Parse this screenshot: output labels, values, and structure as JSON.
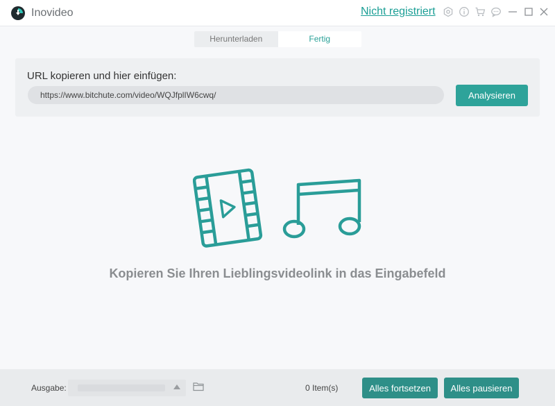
{
  "app": {
    "title": "Inovideo",
    "register_link": "Nicht registriert",
    "accent_color": "#2aa198"
  },
  "titlebar_icons": [
    "settings-icon",
    "info-icon",
    "cart-icon",
    "feedback-icon",
    "minimize-icon",
    "maximize-icon",
    "close-icon"
  ],
  "tabs": [
    {
      "label": "Herunterladen",
      "active": false
    },
    {
      "label": "Fertig",
      "active": true
    }
  ],
  "url_panel": {
    "label": "URL kopieren und hier einfügen:",
    "value": "https://www.bitchute.com/video/WQJfplIW6cwq/",
    "analyze_label": "Analysieren"
  },
  "empty_state": {
    "hint": "Kopieren Sie Ihren Lieblingsvideolink in das Eingabefeld",
    "icons": [
      "video-film-icon",
      "music-note-icon"
    ]
  },
  "bottom": {
    "output_label": "Ausgabe:",
    "items_count": "0 Item(s)",
    "resume_all_label": "Alles fortsetzen",
    "pause_all_label": "Alles pausieren"
  }
}
